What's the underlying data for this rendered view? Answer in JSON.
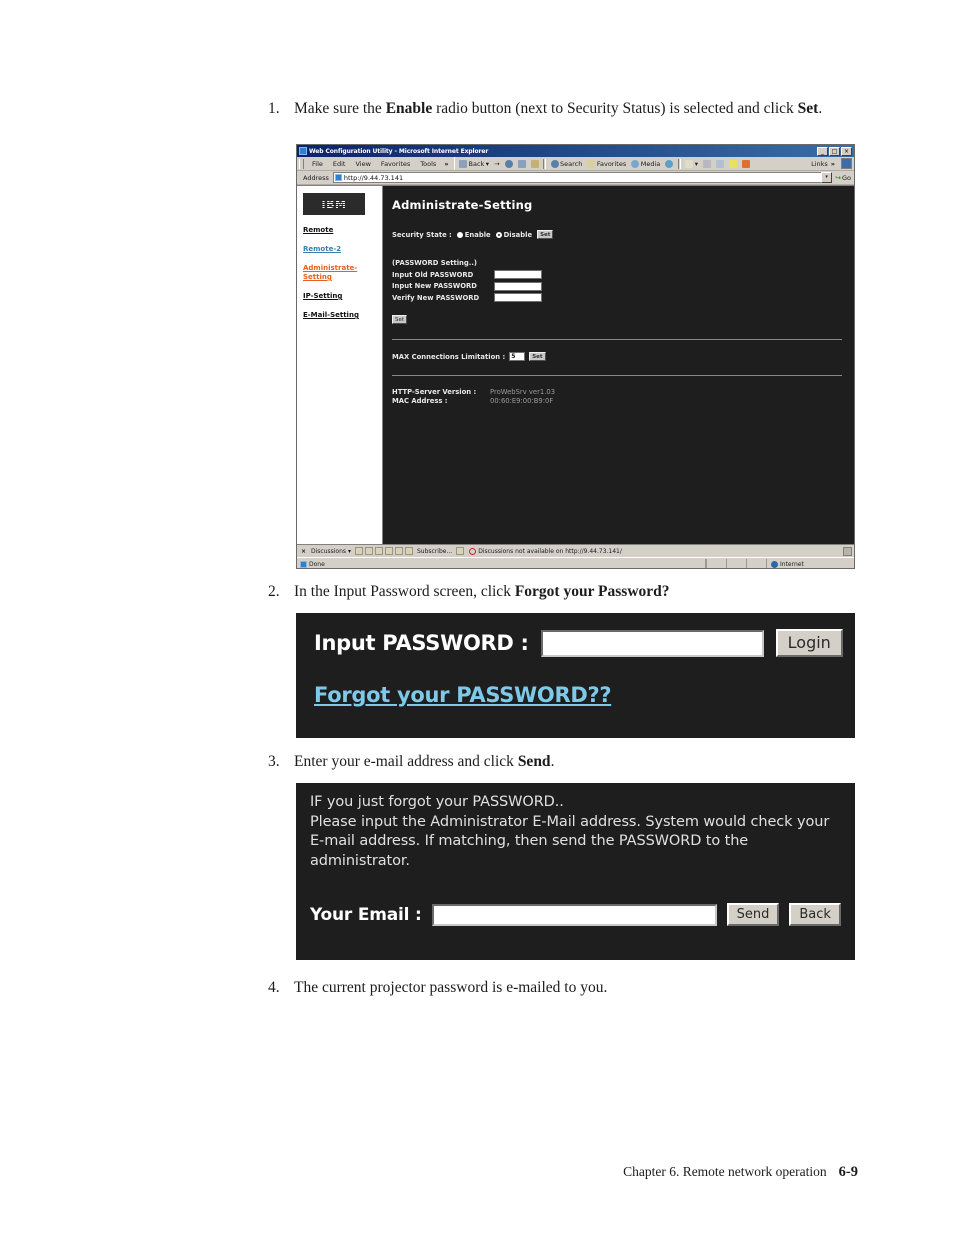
{
  "steps": [
    {
      "num": "1.",
      "parts": [
        {
          "t": "Make sure the ",
          "b": false
        },
        {
          "t": "Enable",
          "b": true
        },
        {
          "t": " radio button (next to Security Status) is selected and click ",
          "b": false
        },
        {
          "t": "Set",
          "b": true
        },
        {
          "t": ".",
          "b": false
        }
      ]
    },
    {
      "num": "2.",
      "parts": [
        {
          "t": "In the Input Password screen, click ",
          "b": false
        },
        {
          "t": "Forgot your Password?",
          "b": true
        }
      ]
    },
    {
      "num": "3.",
      "parts": [
        {
          "t": "Enter your e-mail address and click ",
          "b": false
        },
        {
          "t": "Send",
          "b": true
        },
        {
          "t": ".",
          "b": false
        }
      ]
    },
    {
      "num": "4.",
      "parts": [
        {
          "t": "The current projector password is e-mailed to you.",
          "b": false
        }
      ]
    }
  ],
  "step1_num": "1.",
  "step2_num": "2.",
  "step3_num": "3.",
  "step4_num": "4.",
  "browser": {
    "title": "Web Configuration Utility - Microsoft Internet Explorer",
    "window_buttons": {
      "minimize": "_",
      "restore": "□",
      "close": "×"
    },
    "menu": [
      "File",
      "Edit",
      "View",
      "Favorites",
      "Tools"
    ],
    "menu_overflow": "»",
    "toolbar": {
      "back": "Back",
      "back_caret": "▾",
      "forward": "→",
      "stop": "stop-icon",
      "refresh": "refresh-icon",
      "home": "home-icon",
      "search": "Search",
      "favorites": "Favorites",
      "media": "Media",
      "history": "history-icon",
      "mail": "mail-icon",
      "mail_caret": "▾",
      "print": "print-icon",
      "edit": "edit-icon",
      "discuss": "discuss-icon",
      "messenger": "messenger-icon",
      "links": "Links",
      "links_overflow": "»"
    },
    "address": {
      "label": "Address",
      "url": "http://9.44.73.141",
      "dropdown": "▾",
      "go": "Go",
      "go_arrow": "↪"
    },
    "discussions_bar": {
      "close": "×",
      "discussions": "Discussions",
      "discussions_caret": "▾",
      "subscribe": "Subscribe...",
      "message": "Discussions not available on http://9.44.73.141/"
    },
    "status": {
      "text": "Done",
      "zone": "Internet"
    }
  },
  "webpage": {
    "logo": "IBM",
    "nav": [
      {
        "label": "Remote",
        "color": "dark"
      },
      {
        "label": "Remote-2",
        "color": "blue"
      },
      {
        "label": "Administrate-Setting",
        "color": "red"
      },
      {
        "label": "IP-Setting",
        "color": "dark"
      },
      {
        "label": "E-Mail-Setting",
        "color": "dark"
      }
    ],
    "heading": "Administrate-Setting",
    "security": {
      "label": "Security State :",
      "enable": "Enable",
      "disable": "Disable",
      "selected": "Disable",
      "set": "Set"
    },
    "password_section": {
      "heading": "(PASSWORD Setting..)",
      "fields": [
        {
          "label": "Input Old PASSWORD",
          "value": ""
        },
        {
          "label": "Input New PASSWORD",
          "value": ""
        },
        {
          "label": "Verify New PASSWORD",
          "value": ""
        }
      ],
      "set": "Set"
    },
    "max_connections": {
      "label": "MAX Connections Limitation :",
      "value": "5",
      "set": "Set"
    },
    "info": [
      {
        "key": "HTTP-Server Version :",
        "value": "ProWebSrv ver1.03"
      },
      {
        "key": "MAC Address :",
        "value": "00:60:E9:00:B9:0F"
      }
    ]
  },
  "login_screen": {
    "label": "Input PASSWORD :",
    "value": "",
    "login_button": "Login",
    "forgot_link": "Forgot your PASSWORD??"
  },
  "email_screen": {
    "paragraph": "IF you just forgot your PASSWORD..\nPlease input the Administrator E-Mail address. System would check your E-mail address. If matching, then send the PASSWORD to the administrator.",
    "line1": "IF you just forgot your PASSWORD..",
    "line2": "Please input the Administrator E-Mail address. System would check your E-mail address. If matching, then send the PASSWORD to the administrator.",
    "label": "Your Email :",
    "value": "",
    "send_button": "Send",
    "back_button": "Back"
  },
  "footer": {
    "chapter": "Chapter 6. Remote network operation",
    "page": "6-9"
  },
  "colors": {
    "link_blue": "#3b7fa8",
    "link_red": "#e8601c",
    "forgot_blue": "#7ec8e8",
    "page_bg": "#1e1e1e",
    "chrome": "#d4d0c8",
    "titlebar": "#0a246a"
  }
}
